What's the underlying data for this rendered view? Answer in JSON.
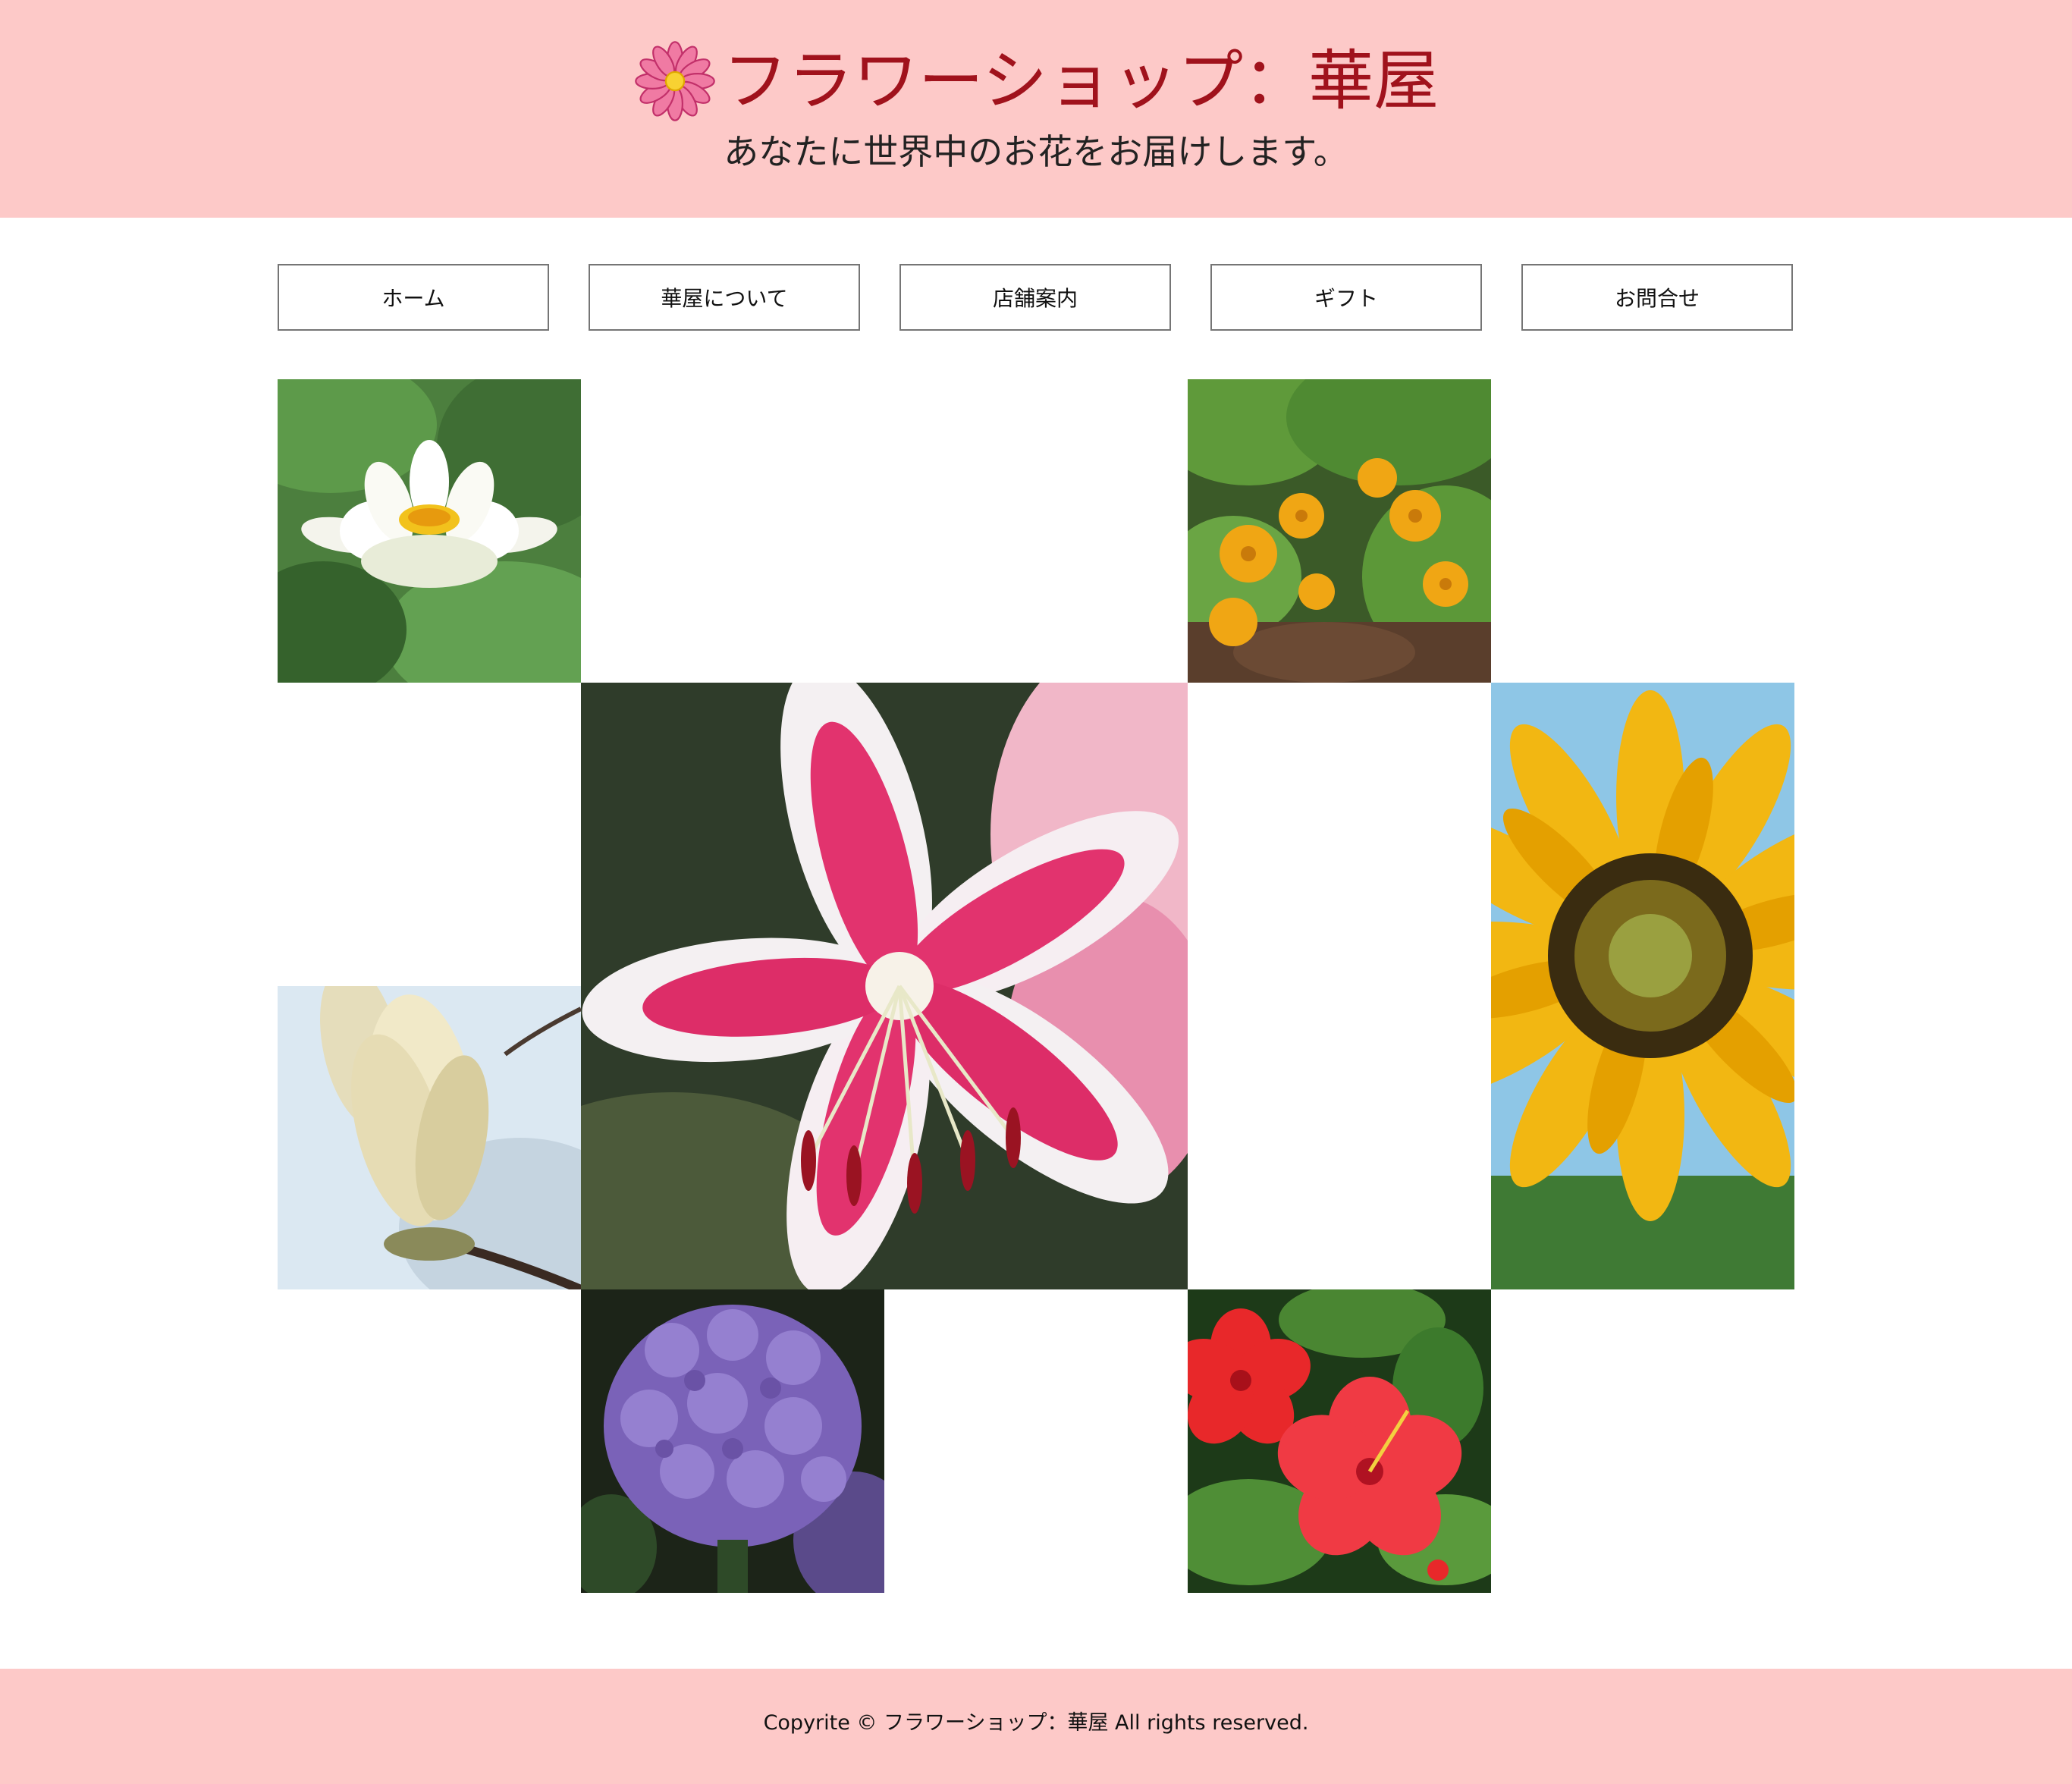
{
  "header": {
    "title": "フラワーショップ：華屋",
    "tagline": "あなたに世界中のお花をお届けします。",
    "logo_icon": "pink-flower-icon",
    "background_color": "#fdc9c8",
    "title_color": "#a0121c"
  },
  "nav": {
    "items": [
      {
        "label": "ホーム"
      },
      {
        "label": "華屋について"
      },
      {
        "label": "店舗案内"
      },
      {
        "label": "ギフト"
      },
      {
        "label": "お問合せ"
      }
    ]
  },
  "gallery": {
    "photos": [
      {
        "subject": "white water lily"
      },
      {
        "subject": "yellow marsh marigold"
      },
      {
        "subject": "pink stargazer lily"
      },
      {
        "subject": "sunflower"
      },
      {
        "subject": "white magnolia bud"
      },
      {
        "subject": "purple hydrangea"
      },
      {
        "subject": "red hibiscus"
      }
    ]
  },
  "footer": {
    "text": "Copyrite © フラワーショップ：華屋 All rights reserved.",
    "background_color": "#fdc9c8"
  }
}
